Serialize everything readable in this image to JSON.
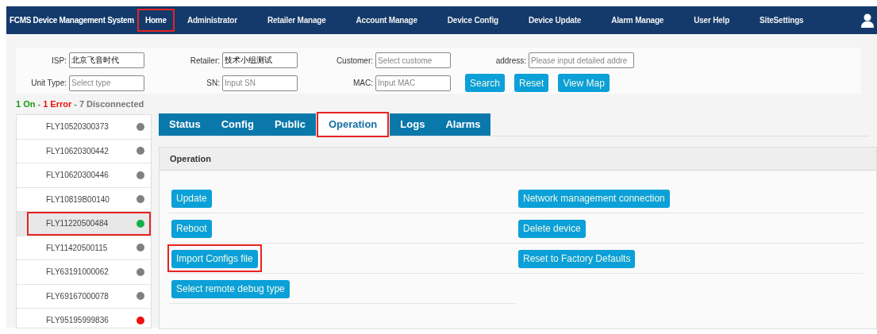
{
  "navbar": {
    "title": "FCMS Device Management System",
    "items": [
      {
        "label": "Home",
        "selected": true,
        "annotated": true
      },
      {
        "label": "Administrator",
        "selected": false,
        "annotated": false
      },
      {
        "label": "Retailer Manage",
        "selected": false,
        "annotated": false
      },
      {
        "label": "Account Manage",
        "selected": false,
        "annotated": false
      },
      {
        "label": "Device Config",
        "selected": false,
        "annotated": false
      },
      {
        "label": "Device Update",
        "selected": false,
        "annotated": false
      },
      {
        "label": "Alarm Manage",
        "selected": false,
        "annotated": false
      },
      {
        "label": "User Help",
        "selected": false,
        "annotated": false
      },
      {
        "label": "SiteSettings",
        "selected": false,
        "annotated": false
      }
    ]
  },
  "filters": [
    [
      {
        "label": "ISP:",
        "value": "北京飞音时代"
      },
      {
        "label": "Retailer:",
        "value": "技术小组测试"
      },
      {
        "label": "Customer:",
        "placeholder": "Select custome"
      },
      {
        "label": "address:",
        "placeholder": "Please input detailed addre"
      }
    ],
    [
      {
        "label": "Unit Type:",
        "placeholder": "Select type"
      },
      {
        "label": "SN:",
        "placeholder": "Input SN"
      },
      {
        "label": "MAC:",
        "placeholder": "Input MAC"
      }
    ]
  ],
  "filter_buttons": [
    "Search",
    "Reset",
    "View Map"
  ],
  "summary": [
    {
      "text": "1 On",
      "kind": "on"
    },
    {
      "text": "-",
      "kind": "neutral"
    },
    {
      "text": "1 Error",
      "kind": "error"
    },
    {
      "text": "- 7 Disconnected",
      "kind": "neutral"
    }
  ],
  "devices": [
    {
      "sn": "FLY10520300373",
      "color": "#808080",
      "selected": false,
      "annotated": false
    },
    {
      "sn": "FLY10620300442",
      "color": "#808080",
      "selected": false,
      "annotated": false
    },
    {
      "sn": "FLY10620300446",
      "color": "#808080",
      "selected": false,
      "annotated": false
    },
    {
      "sn": "FLY10819B00140",
      "color": "#808080",
      "selected": false,
      "annotated": false
    },
    {
      "sn": "FLY11220500484",
      "color": "#16b04a",
      "selected": true,
      "annotated": true
    },
    {
      "sn": "FLY11420500115",
      "color": "#808080",
      "selected": false,
      "annotated": false
    },
    {
      "sn": "FLY63191000062",
      "color": "#808080",
      "selected": false,
      "annotated": false
    },
    {
      "sn": "FLY69167000078",
      "color": "#808080",
      "selected": false,
      "annotated": false
    },
    {
      "sn": "FLY95195999836",
      "color": "#ee1111",
      "selected": false,
      "annotated": false
    }
  ],
  "tabs": [
    {
      "label": "Status",
      "selected": false,
      "annotated": false
    },
    {
      "label": "Config",
      "selected": false,
      "annotated": false
    },
    {
      "label": "Public",
      "selected": false,
      "annotated": false
    },
    {
      "label": "Operation",
      "selected": true,
      "annotated": true
    },
    {
      "label": "Logs",
      "selected": false,
      "annotated": false
    },
    {
      "label": "Alarms",
      "selected": false,
      "annotated": false
    }
  ],
  "panel": {
    "title": "Operation",
    "left_actions": [
      {
        "label": "Update",
        "annotated": false
      },
      {
        "label": "Reboot",
        "annotated": false
      },
      {
        "label": "Import Configs file",
        "annotated": true
      },
      {
        "label": "Select remote debug type",
        "annotated": false
      }
    ],
    "right_actions": [
      {
        "label": "Network management connection",
        "annotated": false
      },
      {
        "label": "Delete device",
        "annotated": false
      },
      {
        "label": "Reset to Factory Defaults",
        "annotated": false
      }
    ]
  }
}
